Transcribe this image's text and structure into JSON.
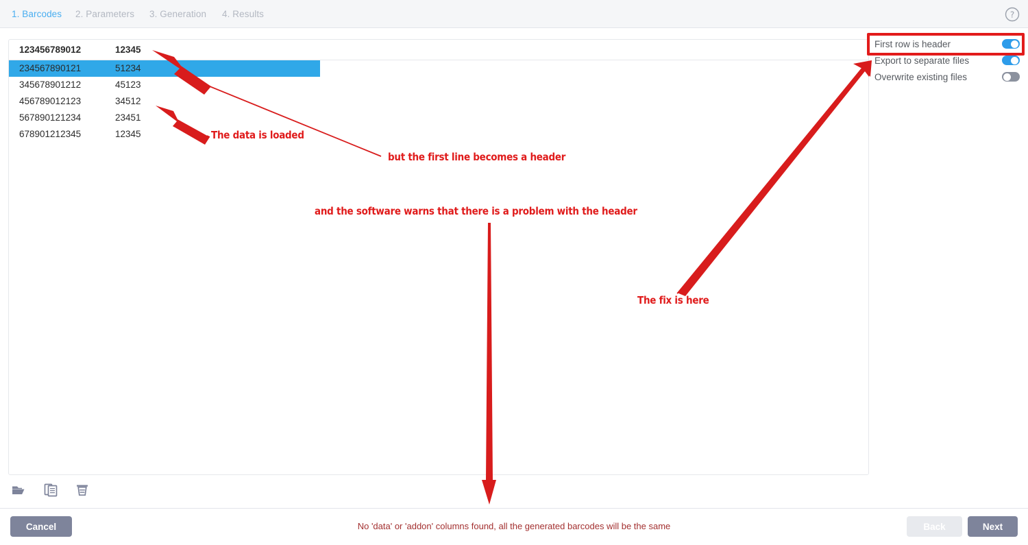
{
  "tabs": [
    {
      "label": "1. Barcodes",
      "active": true
    },
    {
      "label": "2. Parameters",
      "active": false
    },
    {
      "label": "3. Generation",
      "active": false
    },
    {
      "label": "4. Results",
      "active": false
    }
  ],
  "help": {
    "icon": "help-circle-icon"
  },
  "table": {
    "header": [
      "123456789012",
      "12345"
    ],
    "rows": [
      {
        "cells": [
          "234567890121",
          "51234"
        ],
        "selected": true
      },
      {
        "cells": [
          "345678901212",
          "45123"
        ],
        "selected": false
      },
      {
        "cells": [
          "456789012123",
          "34512"
        ],
        "selected": false
      },
      {
        "cells": [
          "567890121234",
          "23451"
        ],
        "selected": false
      },
      {
        "cells": [
          "678901212345",
          "12345"
        ],
        "selected": false
      }
    ]
  },
  "toolbar": {
    "icons": [
      {
        "name": "open-folder-icon",
        "title": "Open"
      },
      {
        "name": "copy-paste-icon",
        "title": "Paste"
      },
      {
        "name": "trash-delete-icon",
        "title": "Delete"
      }
    ]
  },
  "settings": {
    "rows": [
      {
        "label": "First row is header",
        "state": "on",
        "highlighted": true
      },
      {
        "label": "Export to separate files",
        "state": "on",
        "highlighted": false
      },
      {
        "label": "Overwrite existing files",
        "state": "off",
        "highlighted": false
      }
    ]
  },
  "footer": {
    "cancel_label": "Cancel",
    "back_label": "Back",
    "next_label": "Next",
    "status_message": "No 'data' or 'addon' columns found, all the generated barcodes will be the same"
  },
  "annotations": [
    {
      "text": "The data is loaded"
    },
    {
      "text": "but the first line becomes a header"
    },
    {
      "text": "and the software warns that there is a problem with the header"
    },
    {
      "text": "The fix is here"
    }
  ],
  "colors": {
    "accent_blue": "#4aaef0",
    "selection_blue": "#30a8e8",
    "toggle_on": "#2d9cea",
    "toggle_off": "#8c929f",
    "button_grey": "#7e849b",
    "annotation_red": "#e01b1b",
    "warning_red": "#a33030"
  }
}
